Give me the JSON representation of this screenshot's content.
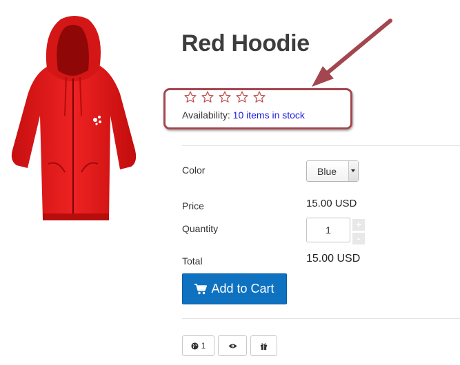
{
  "product": {
    "title": "Red Hoodie",
    "rating": {
      "value": 0,
      "max": 5,
      "star_color": "#c0504d"
    },
    "availability_label": "Availability:",
    "availability_value": "10 items in stock",
    "image_color": "#e51b1b"
  },
  "options": {
    "color_label": "Color",
    "color_selected": "Blue",
    "price_label": "Price",
    "price_value": "15.00 USD",
    "quantity_label": "Quantity",
    "quantity_value": "1",
    "quantity_plus": "+",
    "quantity_minus": "-",
    "total_label": "Total",
    "total_value": "15.00 USD"
  },
  "actions": {
    "add_to_cart_label": "Add to Cart",
    "add_to_cart_color": "#0e72c1",
    "social_count": "1"
  },
  "annotation": {
    "highlight_color": "#a3464f"
  },
  "icons": {
    "cart": "shopping-cart-icon",
    "globe": "globe-icon",
    "eye": "eye-icon",
    "gift": "gift-icon",
    "star": "star-outline-icon"
  }
}
